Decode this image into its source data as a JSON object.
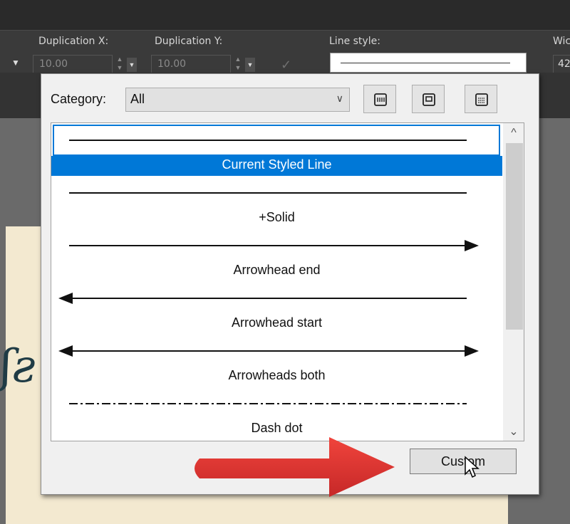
{
  "toolbar": {
    "dup_x_label": "Duplication X:",
    "dup_x_value": "10.00",
    "dup_y_label": "Duplication Y:",
    "dup_y_value": "10.00",
    "line_style_label": "Line style:",
    "width_label": "Wic",
    "width_value": "42"
  },
  "popup": {
    "category_label": "Category:",
    "category_value": "All",
    "items": [
      {
        "label": "Current Styled Line",
        "kind": "plain",
        "selected": true
      },
      {
        "label": "+Solid",
        "kind": "plain"
      },
      {
        "label": "Arrowhead end",
        "kind": "arrow-end"
      },
      {
        "label": "Arrowhead start",
        "kind": "arrow-start"
      },
      {
        "label": "Arrowheads both",
        "kind": "arrow-both"
      },
      {
        "label": "Dash dot",
        "kind": "dash-dot"
      }
    ],
    "custom_button": "Custom"
  },
  "colors": {
    "selection": "#0078d7",
    "annotation_arrow": "#e53935"
  }
}
